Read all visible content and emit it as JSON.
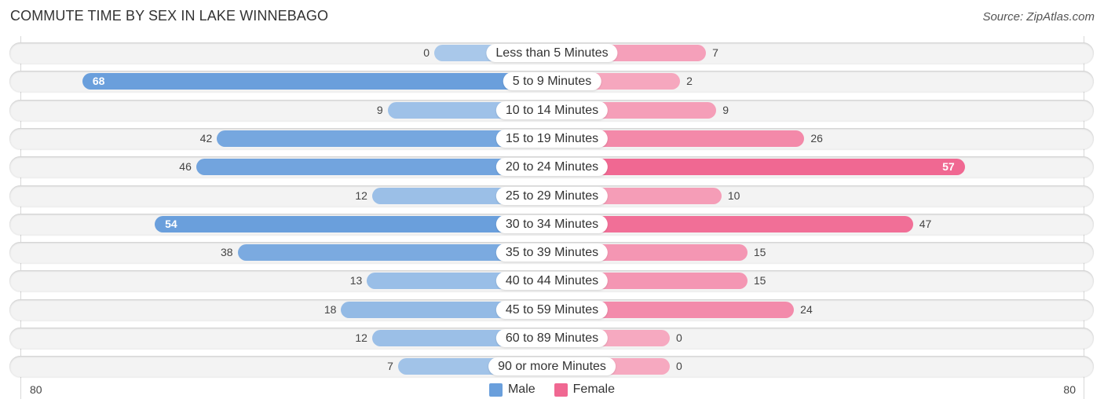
{
  "header": {
    "title": "COMMUTE TIME BY SEX IN LAKE WINNEBAGO",
    "source": "Source: ZipAtlas.com"
  },
  "colors": {
    "male": "#6a9fdc",
    "male_light": "#a9c8ea",
    "female": "#f06892",
    "female_light": "#f6a9c0"
  },
  "chart_data": {
    "type": "bar",
    "orientation": "horizontal-diverging",
    "title": "COMMUTE TIME BY SEX IN LAKE WINNEBAGO",
    "categories": [
      "Less than 5 Minutes",
      "5 to 9 Minutes",
      "10 to 14 Minutes",
      "15 to 19 Minutes",
      "20 to 24 Minutes",
      "25 to 29 Minutes",
      "30 to 34 Minutes",
      "35 to 39 Minutes",
      "40 to 44 Minutes",
      "45 to 59 Minutes",
      "60 to 89 Minutes",
      "90 or more Minutes"
    ],
    "series": [
      {
        "name": "Male",
        "values": [
          0,
          68,
          9,
          42,
          46,
          12,
          54,
          38,
          13,
          18,
          12,
          7
        ]
      },
      {
        "name": "Female",
        "values": [
          7,
          2,
          9,
          26,
          57,
          10,
          47,
          15,
          15,
          24,
          0,
          0
        ]
      }
    ],
    "xlim": [
      -80,
      80
    ],
    "axis_labels": {
      "left": "80",
      "right": "80"
    },
    "legend": {
      "position": "bottom-center",
      "entries": [
        "Male",
        "Female"
      ]
    },
    "grid": false
  }
}
